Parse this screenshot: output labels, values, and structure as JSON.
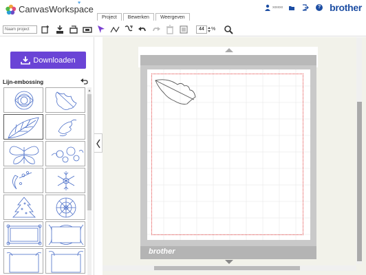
{
  "app": {
    "title": "CanvasWorkspace",
    "brand": "brother"
  },
  "tabs": [
    {
      "label": "Project"
    },
    {
      "label": "Bewerken"
    },
    {
      "label": "Weergeven"
    }
  ],
  "user": {
    "name": "xxxxxx"
  },
  "toolbar": {
    "project_placeholder": "Naam project",
    "zoom_value": "44",
    "zoom_unit": "%"
  },
  "left_panel": {
    "download_label": "Downloaden",
    "category_title": "Lijn-embossing"
  },
  "mat": {
    "brand": "brother"
  },
  "colors": {
    "accent": "#6a44d6",
    "brand": "#1d4ea3",
    "cut_line": "#e23a3a",
    "pattern": "#4a6ec8"
  },
  "icons": [
    "download-icon",
    "back-icon",
    "user-icon",
    "help-icon",
    "zoom-icon"
  ]
}
